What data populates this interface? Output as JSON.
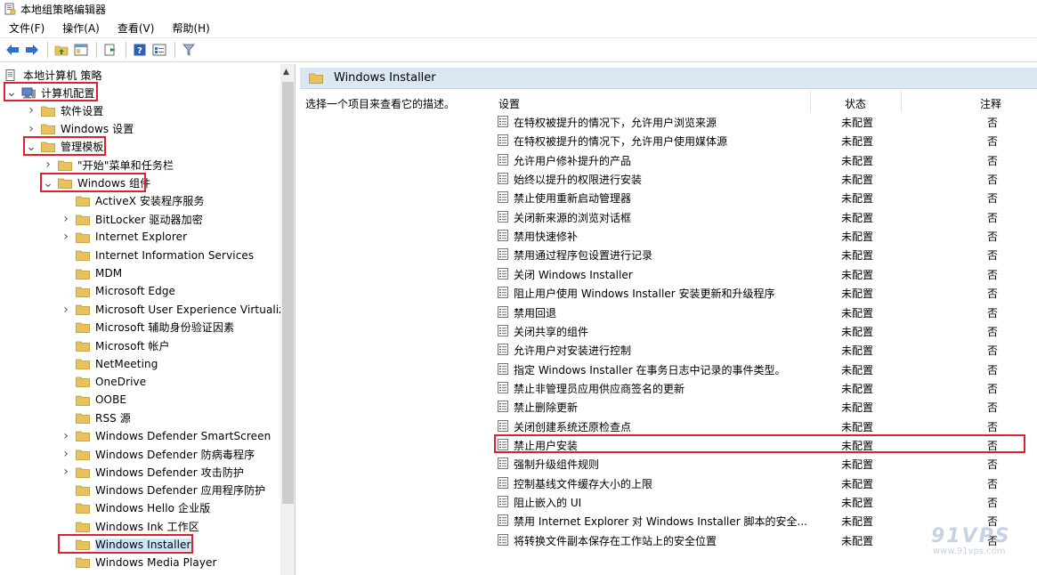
{
  "window": {
    "title": "本地组策略编辑器"
  },
  "menu": [
    "文件(F)",
    "操作(A)",
    "查看(V)",
    "帮助(H)"
  ],
  "tree": {
    "root": "本地计算机 策略",
    "items": [
      {
        "label": "计算机配置",
        "level": 0,
        "expander": "open",
        "icon": "computer-icon",
        "highlight": true
      },
      {
        "label": "软件设置",
        "level": 1,
        "expander": "closed",
        "icon": "folder-icon"
      },
      {
        "label": "Windows 设置",
        "level": 1,
        "expander": "closed",
        "icon": "folder-icon"
      },
      {
        "label": "管理模板",
        "level": 1,
        "expander": "open",
        "icon": "folder-icon",
        "highlight": true
      },
      {
        "label": "\"开始\"菜单和任务栏",
        "level": 2,
        "expander": "closed",
        "icon": "folder-icon"
      },
      {
        "label": "Windows 组件",
        "level": 2,
        "expander": "open",
        "icon": "folder-icon",
        "highlight": true
      },
      {
        "label": "ActiveX 安装程序服务",
        "level": 3,
        "expander": "none",
        "icon": "folder-icon"
      },
      {
        "label": "BitLocker 驱动器加密",
        "level": 3,
        "expander": "closed",
        "icon": "folder-icon"
      },
      {
        "label": "Internet Explorer",
        "level": 3,
        "expander": "closed",
        "icon": "folder-icon"
      },
      {
        "label": "Internet Information Services",
        "level": 3,
        "expander": "none",
        "icon": "folder-icon"
      },
      {
        "label": "MDM",
        "level": 3,
        "expander": "none",
        "icon": "folder-icon"
      },
      {
        "label": "Microsoft Edge",
        "level": 3,
        "expander": "none",
        "icon": "folder-icon"
      },
      {
        "label": "Microsoft User Experience Virtualiz",
        "level": 3,
        "expander": "closed",
        "icon": "folder-icon"
      },
      {
        "label": "Microsoft 辅助身份验证因素",
        "level": 3,
        "expander": "none",
        "icon": "folder-icon"
      },
      {
        "label": "Microsoft 帐户",
        "level": 3,
        "expander": "none",
        "icon": "folder-icon"
      },
      {
        "label": "NetMeeting",
        "level": 3,
        "expander": "none",
        "icon": "folder-icon"
      },
      {
        "label": "OneDrive",
        "level": 3,
        "expander": "none",
        "icon": "folder-icon"
      },
      {
        "label": "OOBE",
        "level": 3,
        "expander": "none",
        "icon": "folder-icon"
      },
      {
        "label": "RSS 源",
        "level": 3,
        "expander": "none",
        "icon": "folder-icon"
      },
      {
        "label": "Windows Defender SmartScreen",
        "level": 3,
        "expander": "closed",
        "icon": "folder-icon"
      },
      {
        "label": "Windows Defender 防病毒程序",
        "level": 3,
        "expander": "closed",
        "icon": "folder-icon"
      },
      {
        "label": "Windows Defender 攻击防护",
        "level": 3,
        "expander": "closed",
        "icon": "folder-icon"
      },
      {
        "label": "Windows Defender 应用程序防护",
        "level": 3,
        "expander": "none",
        "icon": "folder-icon"
      },
      {
        "label": "Windows Hello 企业版",
        "level": 3,
        "expander": "none",
        "icon": "folder-icon"
      },
      {
        "label": "Windows Ink 工作区",
        "level": 3,
        "expander": "none",
        "icon": "folder-icon"
      },
      {
        "label": "Windows Installer",
        "level": 3,
        "expander": "none",
        "icon": "folder-icon",
        "highlight": true,
        "selected": true
      },
      {
        "label": "Windows Media Player",
        "level": 3,
        "expander": "none",
        "icon": "folder-icon"
      }
    ]
  },
  "details": {
    "header": "Windows Installer",
    "description": "选择一个项目来查看它的描述。",
    "columns": {
      "setting": "设置",
      "state": "状态",
      "comment": "注释"
    },
    "rows": [
      {
        "name": "在特权被提升的情况下，允许用户浏览来源",
        "state": "未配置",
        "comment": "否"
      },
      {
        "name": "在特权被提升的情况下，允许用户使用媒体源",
        "state": "未配置",
        "comment": "否"
      },
      {
        "name": "允许用户修补提升的产品",
        "state": "未配置",
        "comment": "否"
      },
      {
        "name": "始终以提升的权限进行安装",
        "state": "未配置",
        "comment": "否"
      },
      {
        "name": "禁止使用重新启动管理器",
        "state": "未配置",
        "comment": "否"
      },
      {
        "name": "关闭新来源的浏览对话框",
        "state": "未配置",
        "comment": "否"
      },
      {
        "name": "禁用快速修补",
        "state": "未配置",
        "comment": "否"
      },
      {
        "name": "禁用通过程序包设置进行记录",
        "state": "未配置",
        "comment": "否"
      },
      {
        "name": "关闭 Windows Installer",
        "state": "未配置",
        "comment": "否"
      },
      {
        "name": "阻止用户使用 Windows Installer 安装更新和升级程序",
        "state": "未配置",
        "comment": "否"
      },
      {
        "name": "禁用回退",
        "state": "未配置",
        "comment": "否"
      },
      {
        "name": "关闭共享的组件",
        "state": "未配置",
        "comment": "否"
      },
      {
        "name": "允许用户对安装进行控制",
        "state": "未配置",
        "comment": "否"
      },
      {
        "name": "指定 Windows Installer 在事务日志中记录的事件类型。",
        "state": "未配置",
        "comment": "否"
      },
      {
        "name": "禁止非管理员应用供应商签名的更新",
        "state": "未配置",
        "comment": "否"
      },
      {
        "name": "禁止删除更新",
        "state": "未配置",
        "comment": "否"
      },
      {
        "name": "关闭创建系统还原检查点",
        "state": "未配置",
        "comment": "否"
      },
      {
        "name": "禁止用户安装",
        "state": "未配置",
        "comment": "否",
        "highlight": true
      },
      {
        "name": "强制升级组件规则",
        "state": "未配置",
        "comment": "否"
      },
      {
        "name": "控制基线文件缓存大小的上限",
        "state": "未配置",
        "comment": "否"
      },
      {
        "name": "阻止嵌入的 UI",
        "state": "未配置",
        "comment": "否"
      },
      {
        "name": "禁用 Internet Explorer 对 Windows Installer 脚本的安全...",
        "state": "未配置",
        "comment": "否"
      },
      {
        "name": "将转换文件副本保存在工作站上的安全位置",
        "state": "未配置",
        "comment": "否"
      }
    ]
  },
  "watermark": {
    "brand": "91VPS",
    "url": "www.91vps.com"
  },
  "colors": {
    "highlight": "#e0202a",
    "header_bg": "#dbe7f3",
    "folder": "#e8c25a"
  }
}
